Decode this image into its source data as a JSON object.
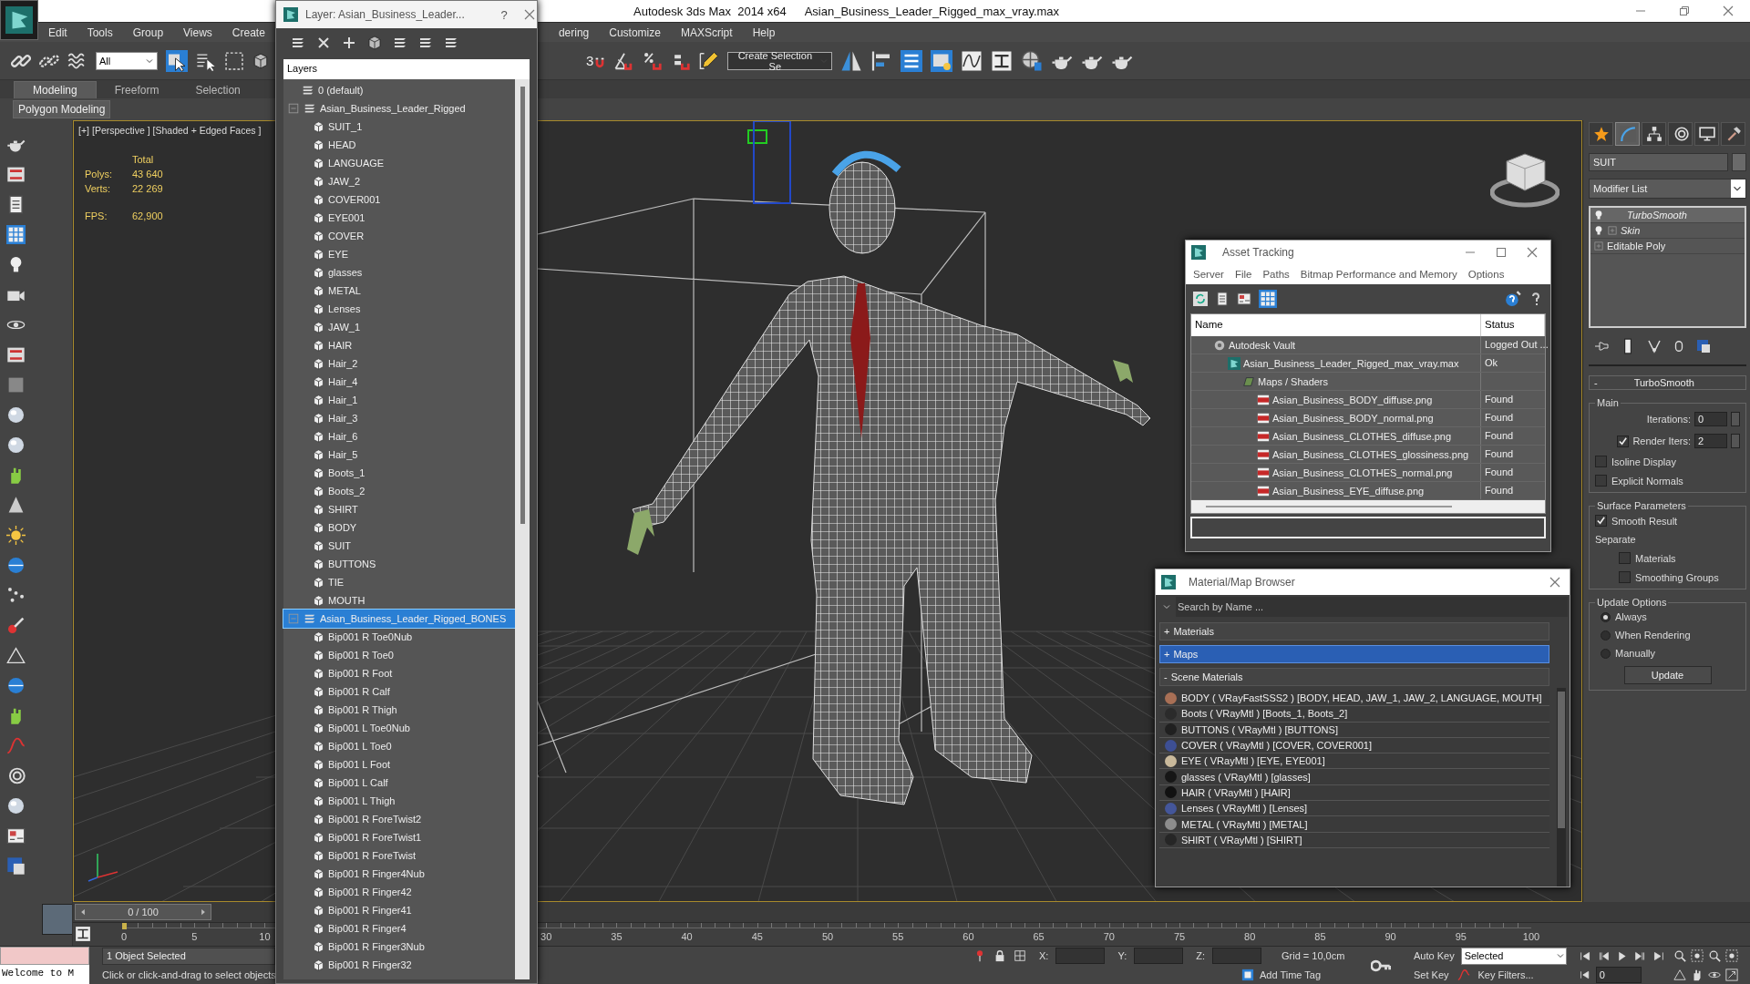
{
  "window": {
    "title": "Autodesk 3ds Max  2014 x64",
    "file": "Asian_Business_Leader_Rigged_max_vray.max"
  },
  "menu_left": [
    "Edit",
    "Tools",
    "Group",
    "Views",
    "Create"
  ],
  "menu_right": [
    "dering",
    "Customize",
    "MAXScript",
    "Help"
  ],
  "toolbar": {
    "selection_filter": "All",
    "snap_toggle": "3",
    "named_selection": "Create Selection Se"
  },
  "ribbon": {
    "tabs": [
      {
        "label": "Modeling",
        "selected": true
      },
      {
        "label": "Freeform",
        "selected": false
      },
      {
        "label": "Selection",
        "selected": false
      }
    ],
    "panel": "Polygon Modeling"
  },
  "viewport": {
    "labels": [
      "[+]",
      "[Perspective ]",
      "[Shaded + Edged Faces ]"
    ],
    "stats_header": "Total",
    "stats": [
      {
        "label": "Polys:",
        "value": "43 640"
      },
      {
        "label": "Verts:",
        "value": "22 269"
      }
    ],
    "fps_label": "FPS:",
    "fps": "62,900"
  },
  "command_panel": {
    "tabs": [
      {
        "selected": false
      },
      {
        "selected": true
      },
      {
        "selected": false
      },
      {
        "selected": false
      },
      {
        "selected": false
      },
      {
        "selected": false
      }
    ],
    "object_name": "SUIT",
    "modifier_list": "Modifier List",
    "stack": [
      {
        "label": "TurboSmooth",
        "kind": "modifier",
        "expandable": false,
        "selected": true
      },
      {
        "label": "Skin",
        "kind": "modifier",
        "expandable": true,
        "selected": false
      },
      {
        "label": "Editable Poly",
        "kind": "base",
        "expandable": true,
        "selected": false
      }
    ],
    "turbosmooth": {
      "toggle": "-",
      "title": "TurboSmooth",
      "main": {
        "title": "Main",
        "iterations": {
          "label": "Iterations:",
          "value": "0"
        },
        "render_iters": {
          "label": "Render Iters:",
          "value": "2",
          "checked": true
        },
        "checks": [
          {
            "label": "Isoline Display",
            "checked": false
          },
          {
            "label": "Explicit Normals",
            "checked": false
          }
        ]
      },
      "surface": {
        "title": "Surface Parameters",
        "smooth_result": {
          "label": "Smooth Result",
          "checked": true
        },
        "separate": "Separate",
        "checks": [
          {
            "label": "Materials",
            "checked": false
          },
          {
            "label": "Smoothing Groups",
            "checked": false
          }
        ]
      },
      "update": {
        "title": "Update Options",
        "options": [
          {
            "label": "Always",
            "selected": true
          },
          {
            "label": "When Rendering",
            "selected": false
          },
          {
            "label": "Manually",
            "selected": false
          }
        ],
        "button": "Update"
      }
    }
  },
  "timeline": {
    "frame": "0 / 100",
    "ticks": [
      "0",
      "5",
      "10",
      "30",
      "35",
      "40",
      "45",
      "50",
      "55",
      "60",
      "65",
      "70",
      "75",
      "80",
      "85",
      "90",
      "95",
      "100"
    ]
  },
  "status": {
    "listener": "Welcome to M",
    "selection": "1 Object Selected",
    "prompt": "Click or click-and-drag to select objects",
    "coords": [
      "X:",
      "Y:",
      "Z:"
    ],
    "grid": "Grid = 10,0cm",
    "add_time_tag": "Add Time Tag",
    "auto_key": "Auto Key",
    "key_mode": "Selected",
    "set_key": "Set Key",
    "key_filters": "Key Filters...",
    "current_frame": "0"
  },
  "layer_window": {
    "title": "Layer: Asian_Business_Leader...",
    "help": "?",
    "header": "Layers",
    "layers": [
      {
        "label": "0 (default)",
        "selected": false
      },
      {
        "label": "Asian_Business_Leader_Rigged",
        "selected": false,
        "expanded": true,
        "children": [
          {
            "label": "SUIT_1",
            "selected": false
          },
          {
            "label": "HEAD",
            "selected": false
          },
          {
            "label": "LANGUAGE",
            "selected": false
          },
          {
            "label": "JAW_2",
            "selected": false
          },
          {
            "label": "COVER001",
            "selected": false
          },
          {
            "label": "EYE001",
            "selected": false
          },
          {
            "label": "COVER",
            "selected": false
          },
          {
            "label": "EYE",
            "selected": false
          },
          {
            "label": "glasses",
            "selected": false
          },
          {
            "label": "METAL",
            "selected": false
          },
          {
            "label": "Lenses",
            "selected": false
          },
          {
            "label": "JAW_1",
            "selected": false
          },
          {
            "label": "HAIR",
            "selected": false
          },
          {
            "label": "Hair_2",
            "selected": false
          },
          {
            "label": "Hair_4",
            "selected": false
          },
          {
            "label": "Hair_1",
            "selected": false
          },
          {
            "label": "Hair_3",
            "selected": false
          },
          {
            "label": "Hair_6",
            "selected": false
          },
          {
            "label": "Hair_5",
            "selected": false
          },
          {
            "label": "Boots_1",
            "selected": false
          },
          {
            "label": "Boots_2",
            "selected": false
          },
          {
            "label": "SHIRT",
            "selected": false
          },
          {
            "label": "BODY",
            "selected": false
          },
          {
            "label": "SUIT",
            "selected": false
          },
          {
            "label": "BUTTONS",
            "selected": false
          },
          {
            "label": "TIE",
            "selected": false
          },
          {
            "label": "MOUTH",
            "selected": false
          }
        ]
      },
      {
        "label": "Asian_Business_Leader_Rigged_BONES",
        "selected": true,
        "expanded": true,
        "children": [
          {
            "label": "Bip001 R Toe0Nub",
            "selected": false
          },
          {
            "label": "Bip001 R Toe0",
            "selected": false
          },
          {
            "label": "Bip001 R Foot",
            "selected": false
          },
          {
            "label": "Bip001 R Calf",
            "selected": false
          },
          {
            "label": "Bip001 R Thigh",
            "selected": false
          },
          {
            "label": "Bip001 L Toe0Nub",
            "selected": false
          },
          {
            "label": "Bip001 L Toe0",
            "selected": false
          },
          {
            "label": "Bip001 L Foot",
            "selected": false
          },
          {
            "label": "Bip001 L Calf",
            "selected": false
          },
          {
            "label": "Bip001 L Thigh",
            "selected": false
          },
          {
            "label": "Bip001 R ForeTwist2",
            "selected": false
          },
          {
            "label": "Bip001 R ForeTwist1",
            "selected": false
          },
          {
            "label": "Bip001 R ForeTwist",
            "selected": false
          },
          {
            "label": "Bip001 R Finger4Nub",
            "selected": false
          },
          {
            "label": "Bip001 R Finger42",
            "selected": false
          },
          {
            "label": "Bip001 R Finger41",
            "selected": false
          },
          {
            "label": "Bip001 R Finger4",
            "selected": false
          },
          {
            "label": "Bip001 R Finger3Nub",
            "selected": false
          },
          {
            "label": "Bip001 R Finger32",
            "selected": false
          }
        ]
      }
    ]
  },
  "asset_window": {
    "title": "Asset Tracking",
    "menu": [
      "Server",
      "File",
      "Paths",
      "Bitmap Performance and Memory",
      "Options"
    ],
    "columns": [
      "Name",
      "Status"
    ],
    "tree": [
      {
        "name": "Autodesk Vault",
        "status": "Logged Out ...",
        "kind": "vault",
        "children": [
          {
            "name": "Asian_Business_Leader_Rigged_max_vray.max",
            "status": "Ok",
            "kind": "scene",
            "children": [
              {
                "name": "Maps / Shaders",
                "kind": "folder",
                "children": [
                  {
                    "name": "Asian_Business_BODY_diffuse.png",
                    "status": "Found",
                    "kind": "png"
                  },
                  {
                    "name": "Asian_Business_BODY_normal.png",
                    "status": "Found",
                    "kind": "png"
                  },
                  {
                    "name": "Asian_Business_CLOTHES_diffuse.png",
                    "status": "Found",
                    "kind": "png"
                  },
                  {
                    "name": "Asian_Business_CLOTHES_glossiness.png",
                    "status": "Found",
                    "kind": "png"
                  },
                  {
                    "name": "Asian_Business_CLOTHES_normal.png",
                    "status": "Found",
                    "kind": "png"
                  },
                  {
                    "name": "Asian_Business_EYE_diffuse.png",
                    "status": "Found",
                    "kind": "png"
                  }
                ]
              }
            ]
          }
        ]
      }
    ]
  },
  "material_window": {
    "title": "Material/Map Browser",
    "search_placeholder": "Search by Name ...",
    "groups": [
      {
        "toggle": "+",
        "label": "Materials",
        "selected": false
      },
      {
        "toggle": "+",
        "label": "Maps",
        "selected": true
      },
      {
        "toggle": "-",
        "label": "Scene Materials",
        "selected": false
      }
    ],
    "materials": [
      {
        "label": "BODY ( VRayFastSSS2 ) [BODY, HEAD, JAW_1, JAW_2, LANGUAGE, MOUTH]",
        "color": "#a86f55"
      },
      {
        "label": "Boots ( VRayMtl ) [Boots_1, Boots_2]",
        "color": "#2b2b2b"
      },
      {
        "label": "BUTTONS ( VRayMtl ) [BUTTONS]",
        "color": "#202020"
      },
      {
        "label": "COVER ( VRayMtl ) [COVER, COVER001]",
        "color": "#3d4f94"
      },
      {
        "label": "EYE ( VRayMtl ) [EYE, EYE001]",
        "color": "#c9b99b"
      },
      {
        "label": "glasses ( VRayMtl ) [glasses]",
        "color": "#161616"
      },
      {
        "label": "HAIR ( VRayMtl ) [HAIR]",
        "color": "#111111"
      },
      {
        "label": "Lenses ( VRayMtl ) [Lenses]",
        "color": "#44569a"
      },
      {
        "label": "METAL ( VRayMtl ) [METAL]",
        "color": "#8c8c8c"
      },
      {
        "label": "SHIRT ( VRayMtl ) [SHIRT]",
        "color": "#262626"
      }
    ]
  }
}
